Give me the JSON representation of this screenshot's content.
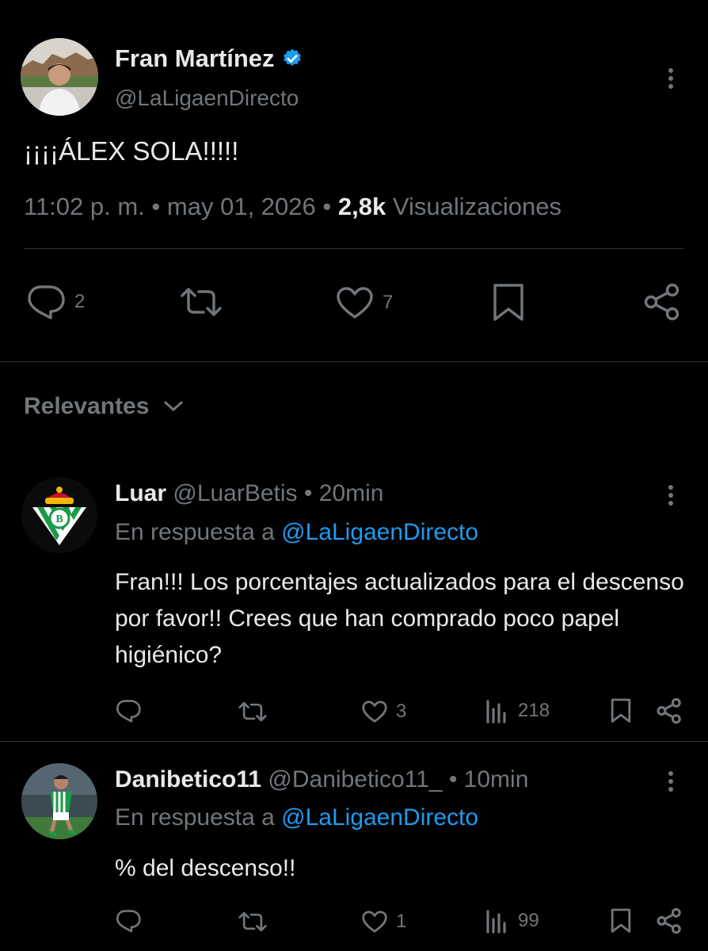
{
  "main_tweet": {
    "author_name": "Fran Martínez",
    "author_handle": "@LaLigaenDirecto",
    "text": "¡¡¡¡ÁLEX SOLA!!!!!",
    "time": "11:02 p. m.",
    "separator": "•",
    "date": "may 01, 2026",
    "views_count": "2,8k",
    "views_label": "Visualizaciones",
    "reply_count": "2",
    "like_count": "7"
  },
  "sort": {
    "label": "Relevantes"
  },
  "replies": [
    {
      "name": "Luar",
      "handle": "@LuarBetis",
      "dot": "•",
      "time": "20min",
      "reply_to_prefix": "En respuesta a",
      "reply_to_handle": "@LaLigaenDirecto",
      "text": "Fran!!! Los porcentajes actualizados para el descenso por favor!! Crees que han comprado poco papel higiénico?",
      "like_count": "3",
      "view_count": "218"
    },
    {
      "name": "Danibetico11",
      "handle": "@Danibetico11_",
      "dot": "•",
      "time": "10min",
      "reply_to_prefix": "En respuesta a",
      "reply_to_handle": "@LaLigaenDirecto",
      "text": "% del descenso!!",
      "like_count": "1",
      "view_count": "99"
    }
  ],
  "colors": {
    "background": "#000000",
    "text": "#e7e9ea",
    "muted": "#71767b",
    "accent": "#1d9bf0",
    "divider": "#2f3336",
    "betis_green": "#1a9b46"
  },
  "icons": [
    "verified-badge-icon",
    "more-icon",
    "reply-icon",
    "retweet-icon",
    "like-icon",
    "bookmark-icon",
    "share-icon",
    "views-icon",
    "chevron-down-icon"
  ]
}
